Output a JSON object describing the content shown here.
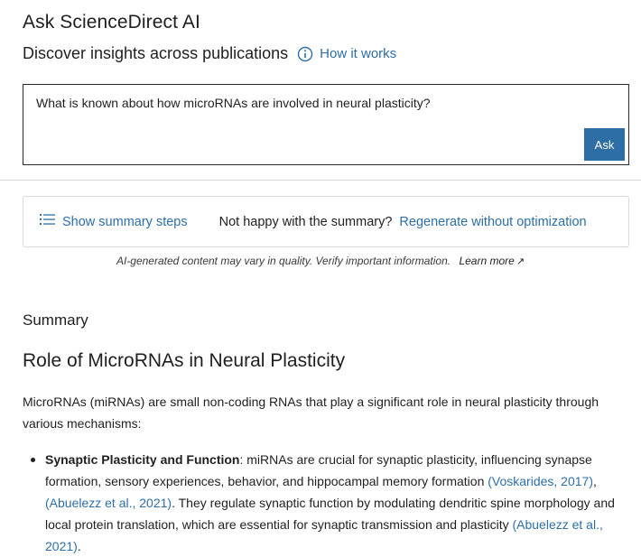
{
  "header": {
    "title": "Ask ScienceDirect AI",
    "subtitle": "Discover insights across publications",
    "how_it_works": "How it works"
  },
  "query": {
    "text": "What is known about how microRNAs are involved in neural plasticity?",
    "ask_label": "Ask"
  },
  "summary_bar": {
    "steps_label": "Show summary steps",
    "not_happy": "Not happy with the summary?",
    "regenerate": "Regenerate without optimization"
  },
  "disclaimer": {
    "text": "AI-generated content may vary in quality. Verify important information.",
    "learn_more": "Learn more",
    "arrow": "↗"
  },
  "summary": {
    "label": "Summary",
    "heading": "Role of MicroRNAs in Neural Plasticity",
    "intro": "MicroRNAs (miRNAs) are small non-coding RNAs that play a significant role in neural plasticity through various mechanisms:",
    "bullet1": {
      "title": "Synaptic Plasticity and Function",
      "text1": ": miRNAs are crucial for synaptic plasticity, influencing synapse formation, sensory experiences, behavior, and hippocampal memory formation ",
      "cite1": "(Voskarides, 2017)",
      "sep1": ", ",
      "cite2": "(Abuelezz et al., 2021)",
      "text2": ". They regulate synaptic function by modulating dendritic spine morphology and local protein translation, which are essential for synaptic transmission and plasticity ",
      "cite3": "(Abuelezz et al., 2021)",
      "end": "."
    }
  },
  "colors": {
    "accent": "#2e6ea6",
    "text": "#1f1f1f",
    "border": "#d9d9d9"
  },
  "icons": {
    "info": "info-circle-icon",
    "steps": "list-icon",
    "external": "external-arrow-icon"
  }
}
